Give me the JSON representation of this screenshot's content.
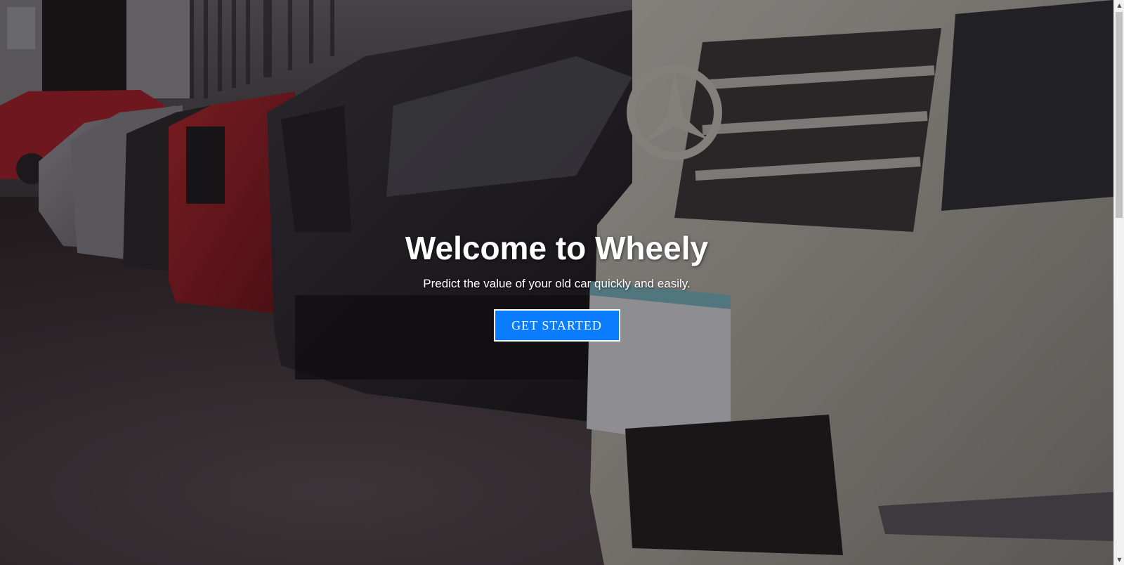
{
  "hero": {
    "title": "Welcome to Wheely",
    "subtitle": "Predict the value of your old car quickly and easily.",
    "cta_label": "GET STARTED",
    "background_image": "row-of-parked-cars-photo"
  },
  "colors": {
    "cta_background": "#0a7cff",
    "cta_border": "#ffffff",
    "text": "#ffffff",
    "overlay": "rgba(20,14,18,0.42)"
  },
  "scrollbar": {
    "up_icon": "chevron-up-icon",
    "down_icon": "chevron-down-icon"
  }
}
